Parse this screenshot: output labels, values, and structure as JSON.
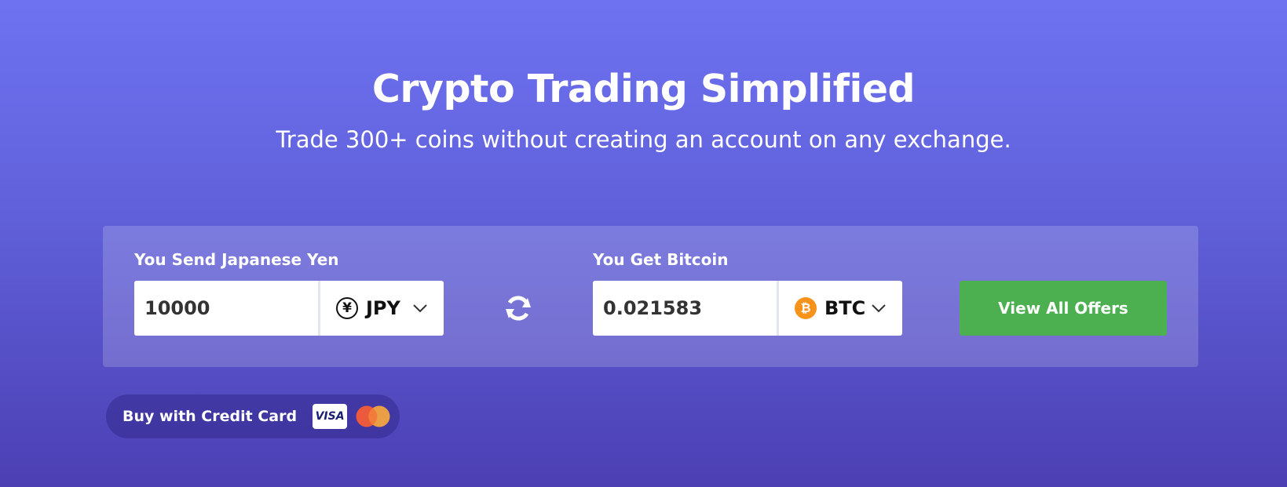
{
  "hero": {
    "title": "Crypto Trading Simplified",
    "subtitle": "Trade 300+ coins without creating an account on any exchange."
  },
  "exchange": {
    "send": {
      "label": "You Send Japanese Yen",
      "amount": "10000",
      "currency_code": "JPY",
      "currency_icon": "yen-icon",
      "currency_symbol": "¥"
    },
    "get": {
      "label": "You Get Bitcoin",
      "amount": "0.021583",
      "currency_code": "BTC",
      "currency_icon": "bitcoin-icon",
      "currency_symbol": "₿"
    },
    "swap_icon": "refresh-swap-icon",
    "offers_button_label": "View All Offers"
  },
  "payment": {
    "label": "Buy with Credit Card",
    "visa_text": "VISA",
    "card_icons": [
      "visa-icon",
      "mastercard-icon"
    ]
  },
  "colors": {
    "background_top": "#6e72f1",
    "background_bottom": "#4c3fb3",
    "offers_button": "#4caf50",
    "bitcoin": "#f7931a",
    "mastercard_red": "#eb5a3c",
    "mastercard_yellow": "#f9a73e"
  }
}
